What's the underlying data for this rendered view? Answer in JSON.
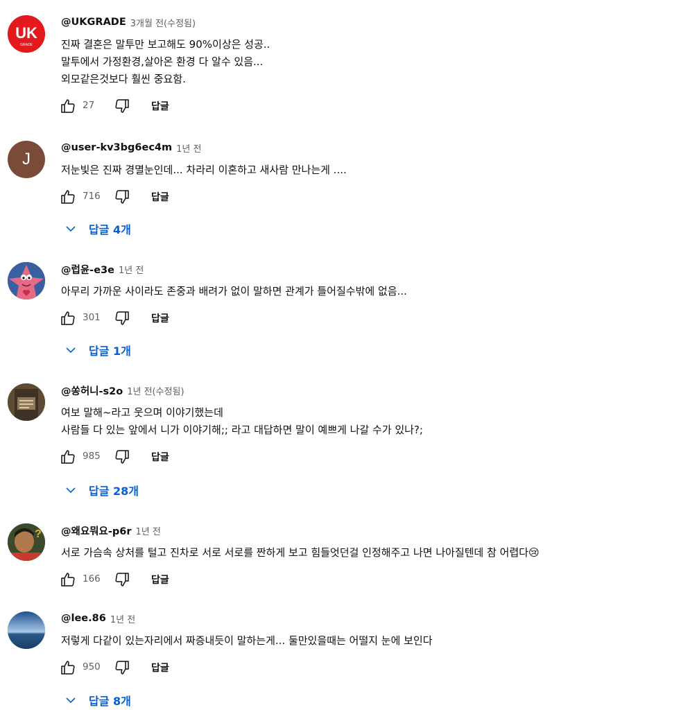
{
  "ui": {
    "reply_label": "답글"
  },
  "comments": [
    {
      "author": "@UKGRADE",
      "time": "3개월 전(수정됨)",
      "lines": [
        "진짜 결혼은 말투만 보고해도 90%이상은 성공..",
        "말투에서 가정환경,살아온 환경 다 알수 있음...",
        "외모같은것보다 훨씬 중요함."
      ],
      "likes": "27",
      "replies": null,
      "avatar": {
        "text": "UK",
        "subtext": "GRADE",
        "bg": "#e3191e",
        "fg": "#ffffff"
      }
    },
    {
      "author": "@user-kv3bg6ec4m",
      "time": "1년 전",
      "lines": [
        "저눈빛은 진짜 경멸눈인데... 차라리 이혼하고 새사람 만나는게 ...."
      ],
      "likes": "716",
      "replies": "답글 4개",
      "avatar": {
        "text": "J",
        "bg": "#7b4b3a",
        "fg": "#ffffff"
      }
    },
    {
      "author": "@럽윤-e3e",
      "time": "1년 전",
      "lines": [
        "아무리 가까운 사이라도  존중과 배려가 없이 말하면 관계가 틀어질수밖에 없음..."
      ],
      "likes": "301",
      "replies": "답글 1개",
      "avatar": {
        "bg": "#3a5fa0",
        "accent": "#e46a86"
      }
    },
    {
      "author": "@쏭허니-s2o",
      "time": "1년 전(수정됨)",
      "lines": [
        "여보 말해~라고 웃으며 이야기했는데",
        "사람들 다 있는 앞에서 니가 이야기해;; 라고 대답하면 말이 예쁘게 나갈 수가 있나?;"
      ],
      "likes": "985",
      "replies": "답글 28개",
      "avatar": {
        "bg": "#6b5a3e",
        "accent": "#d9c7a0"
      }
    },
    {
      "author": "@왜요뭐요-p6r",
      "time": "1년 전",
      "lines": [
        "서로 가슴속 상처를 털고 진차로 서로 서로를 짠하게 보고 힘들엇던걸 인정해주고 나면 나아질텐데 참 어렵다😢"
      ],
      "likes": "166",
      "replies": null,
      "avatar": {
        "bg": "#3c4a2c",
        "accent": "#e3b13a"
      }
    },
    {
      "author": "@lee.86",
      "time": "1년 전",
      "lines": [
        "저렇게 다같이 있는자리에서 짜증내듯이 말하는게... 둘만있을때는 어떨지 눈에 보인다"
      ],
      "likes": "950",
      "replies": "답글 8개",
      "avatar": {
        "bg": "#2a5e9a",
        "accent": "#a9c9ea"
      }
    }
  ]
}
